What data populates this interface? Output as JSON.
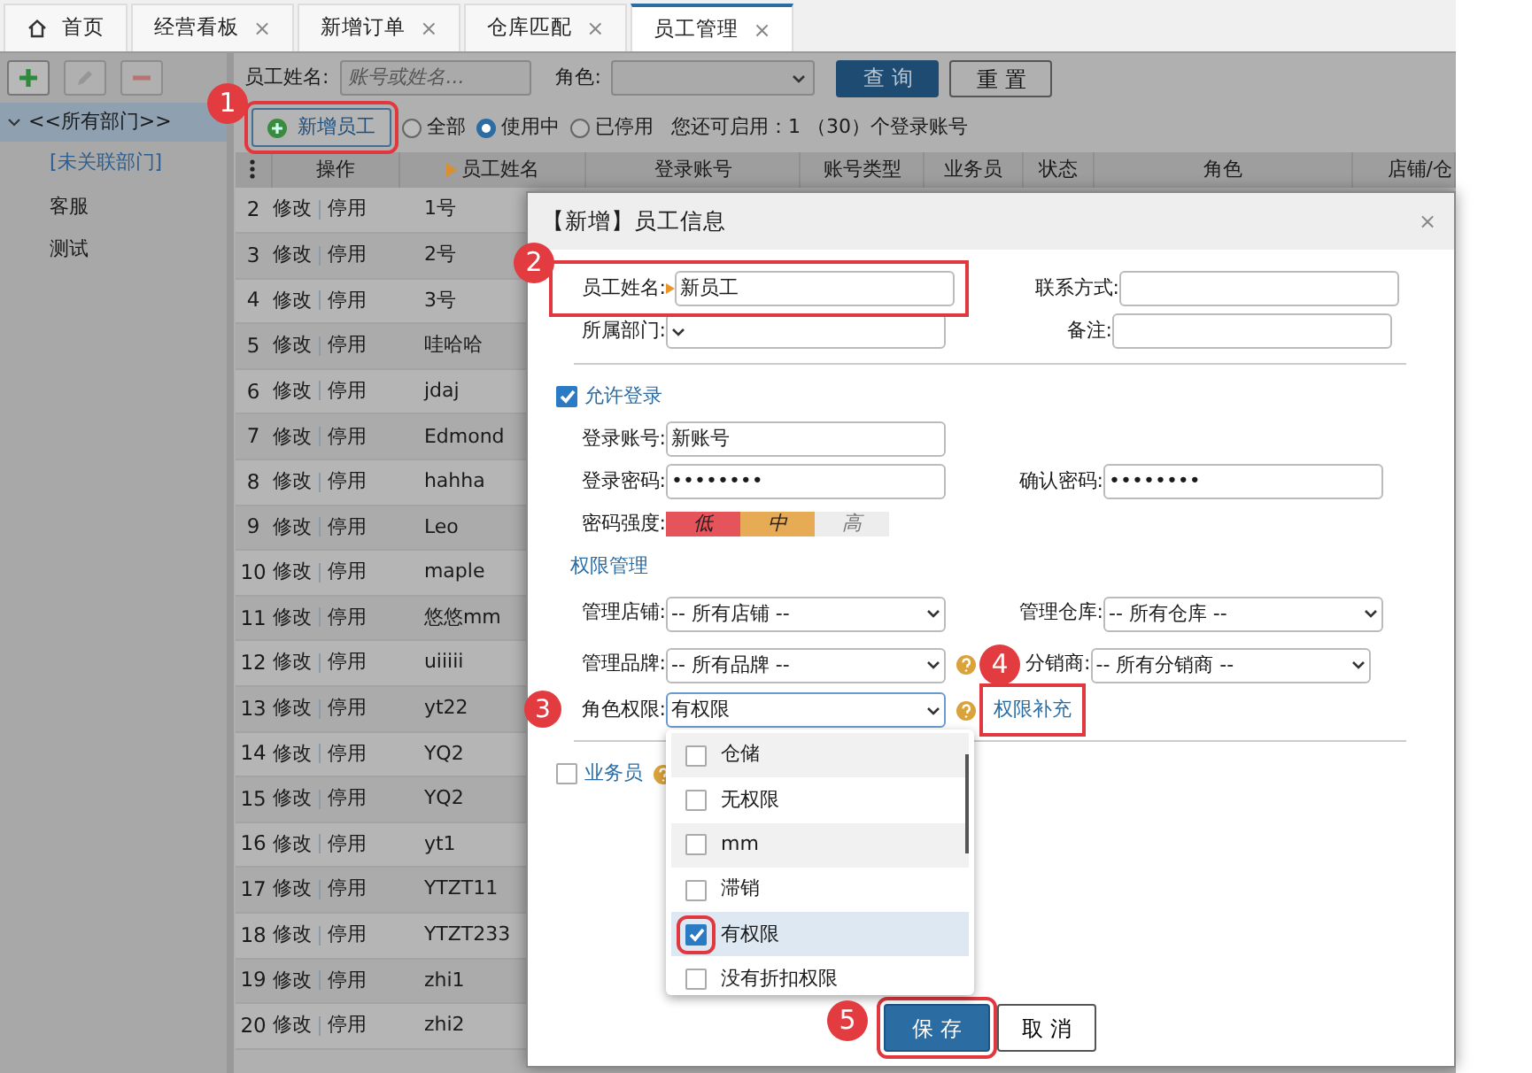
{
  "tabs": [
    {
      "label": "首页",
      "kind": "home",
      "selected": false
    },
    {
      "label": "经营看板",
      "kind": "page",
      "selected": false,
      "close": "×"
    },
    {
      "label": "新增订单",
      "kind": "page",
      "selected": false,
      "close": "×"
    },
    {
      "label": "仓库匹配",
      "kind": "page",
      "selected": false,
      "close": "×"
    },
    {
      "label": "员工管理",
      "kind": "page",
      "selected": true,
      "close": "×"
    }
  ],
  "toolbar": [
    {
      "kind": "add",
      "disabled": false
    },
    {
      "kind": "edit",
      "disabled": true
    },
    {
      "kind": "remove",
      "disabled": true
    }
  ],
  "sidebar": {
    "items": [
      {
        "label": "<<所有部门>>",
        "selected": true,
        "expanded": true,
        "children": [
          {
            "label": "[未关联部门]",
            "kind": "link",
            "selected": false
          },
          {
            "label": "客服",
            "kind": "plain",
            "selected": false
          },
          {
            "label": "测试",
            "kind": "plain",
            "selected": false
          }
        ]
      }
    ]
  },
  "filter": {
    "name_label": "员工姓名:",
    "placeholder": "账号或姓名...",
    "role_label": "角色:",
    "query": "查 询",
    "reset": "重 置"
  },
  "add_button": {
    "label": "新增员工",
    "callout": "1",
    "highlighted": true
  },
  "status_filter": [
    {
      "label": "全部",
      "selected": false
    },
    {
      "label": "使用中",
      "selected": true
    },
    {
      "label": "已停用",
      "selected": false
    }
  ],
  "quota_text": "您还可启用：1 （30）个登录账号",
  "table": {
    "columns": [
      {
        "label": "操作",
        "sorted": false
      },
      {
        "label": "员工姓名",
        "sorted": true
      },
      {
        "label": "登录账号",
        "sorted": false
      },
      {
        "label": "账号类型",
        "sorted": false
      },
      {
        "label": "业务员",
        "sorted": false
      },
      {
        "label": "状态",
        "sorted": false
      },
      {
        "label": "角色",
        "sorted": false
      },
      {
        "label": "店铺/仓",
        "sorted": false
      }
    ],
    "rows": [
      {
        "number": "2",
        "actions": [
          "修改",
          "停用"
        ],
        "name": "1号"
      },
      {
        "number": "3",
        "actions": [
          "修改",
          "停用"
        ],
        "name": "2号"
      },
      {
        "number": "4",
        "actions": [
          "修改",
          "停用"
        ],
        "name": "3号"
      },
      {
        "number": "5",
        "actions": [
          "修改",
          "停用"
        ],
        "name": "哇哈哈"
      },
      {
        "number": "6",
        "actions": [
          "修改",
          "停用"
        ],
        "name": "jdaj"
      },
      {
        "number": "7",
        "actions": [
          "修改",
          "停用"
        ],
        "name": "Edmond"
      },
      {
        "number": "8",
        "actions": [
          "修改",
          "停用"
        ],
        "name": "hahha"
      },
      {
        "number": "9",
        "actions": [
          "修改",
          "停用"
        ],
        "name": "Leo"
      },
      {
        "number": "10",
        "actions": [
          "修改",
          "停用"
        ],
        "name": "maple"
      },
      {
        "number": "11",
        "actions": [
          "修改",
          "停用"
        ],
        "name": "悠悠mm"
      },
      {
        "number": "12",
        "actions": [
          "修改",
          "停用"
        ],
        "name": "uiiiii"
      },
      {
        "number": "13",
        "actions": [
          "修改",
          "停用"
        ],
        "name": "yt22"
      },
      {
        "number": "14",
        "actions": [
          "修改",
          "停用"
        ],
        "name": "YQ2"
      },
      {
        "number": "15",
        "actions": [
          "修改",
          "停用"
        ],
        "name": "YQ2"
      },
      {
        "number": "16",
        "actions": [
          "修改",
          "停用"
        ],
        "name": "yt1"
      },
      {
        "number": "17",
        "actions": [
          "修改",
          "停用"
        ],
        "name": "YTZT11"
      },
      {
        "number": "18",
        "actions": [
          "修改",
          "停用"
        ],
        "name": "YTZT233"
      },
      {
        "number": "19",
        "actions": [
          "修改",
          "停用"
        ],
        "name": "zhi1"
      },
      {
        "number": "20",
        "actions": [
          "修改",
          "停用"
        ],
        "name": "zhi2"
      }
    ]
  },
  "dialog": {
    "title": "【新增】员工信息",
    "close": "×",
    "name": {
      "label": "员工姓名:",
      "value": "新员工",
      "required": true,
      "callout": "2",
      "highlighted": true
    },
    "contact": {
      "label": "联系方式:"
    },
    "department": {
      "label": "所属部门:"
    },
    "note": {
      "label": "备注:"
    },
    "allow_login": {
      "label": "允许登录",
      "checked": true
    },
    "account": {
      "label": "登录账号:",
      "value": "新账号"
    },
    "password": {
      "label": "登录密码:",
      "value": "••••••••"
    },
    "confirm": {
      "label": "确认密码:",
      "value": "••••••••"
    },
    "strength": {
      "label": "密码强度:",
      "levels": [
        {
          "label": "低",
          "on": true,
          "color": "#e5545a"
        },
        {
          "label": "中",
          "on": true,
          "color": "#e8ab55"
        },
        {
          "label": "高",
          "on": false,
          "color": "#ededed"
        }
      ]
    },
    "permissions_heading": "权限管理",
    "shop": {
      "label": "管理店铺:",
      "value": "-- 所有店铺 --"
    },
    "warehouse": {
      "label": "管理仓库:",
      "value": "-- 所有仓库 --"
    },
    "brand": {
      "label": "管理品牌:",
      "value": "-- 所有品牌 --"
    },
    "distributor": {
      "label": "分销商:",
      "value": "-- 所有分销商 --"
    },
    "role": {
      "label": "角色权限:",
      "value": "有权限",
      "callout": "3",
      "link": {
        "label": "权限补充",
        "callout": "4",
        "highlighted": true
      }
    },
    "salesperson": {
      "label": "业务员",
      "checked": false
    },
    "role_options": [
      {
        "label": "仓储",
        "checked": false,
        "highlighted": false
      },
      {
        "label": "无权限",
        "checked": false,
        "highlighted": false
      },
      {
        "label": "mm",
        "checked": false,
        "highlighted": false
      },
      {
        "label": "滞销",
        "checked": false,
        "highlighted": false
      },
      {
        "label": "有权限",
        "checked": true,
        "highlighted": true
      },
      {
        "label": "没有折扣权限",
        "checked": false,
        "highlighted": false
      }
    ],
    "save": {
      "label": "保 存",
      "callout": "5",
      "highlighted": true
    },
    "cancel": {
      "label": "取 消"
    }
  }
}
